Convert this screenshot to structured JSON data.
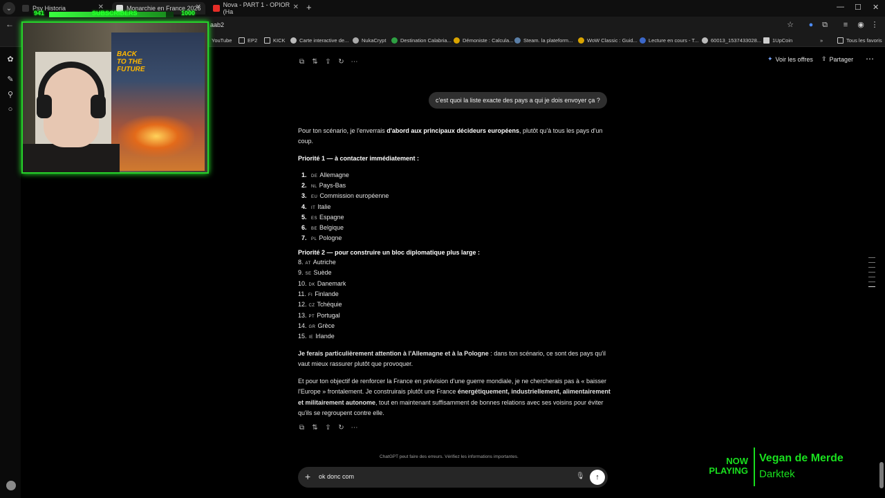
{
  "browser": {
    "tabs": [
      {
        "title": "Psy Historia"
      },
      {
        "title": "Monarchie en France 2026"
      },
      {
        "title": "Nova - PART 1 - OPIOR (Ha"
      }
    ],
    "url": "aab2",
    "bookmarks": [
      "YouTube",
      "EP2",
      "KICK",
      "Carte interactive de...",
      "NukaCrypt",
      "Destination Calabria...",
      "Démoniste : Calcula...",
      "Steam. la plateform...",
      "WoW Classic : Guid...",
      "Lecture en cours - T...",
      "60013_1537433028...",
      "1UpCoin",
      "Tous les favoris"
    ]
  },
  "header": {
    "offers_label": "Voir les offres",
    "share_label": "Partager"
  },
  "conversation": {
    "user_message": "c'est quoi la liste exacte des pays a qui je dois envoyer ça ?",
    "intro_plain_1": "Pour ton scénario, je l'enverrais ",
    "intro_bold": "d'abord aux principaux décideurs européens",
    "intro_plain_2": ", plutôt qu'à tous les pays d'un coup.",
    "priority1_heading": "Priorité 1 — à contacter immédiatement :",
    "priority1": [
      {
        "num": "1.",
        "code": "DE",
        "name": "Allemagne"
      },
      {
        "num": "2.",
        "code": "NL",
        "name": "Pays-Bas"
      },
      {
        "num": "3.",
        "code": "EU",
        "name": "Commission européenne"
      },
      {
        "num": "4.",
        "code": "IT",
        "name": "Italie"
      },
      {
        "num": "5.",
        "code": "ES",
        "name": "Espagne"
      },
      {
        "num": "6.",
        "code": "BE",
        "name": "Belgique"
      },
      {
        "num": "7.",
        "code": "PL",
        "name": "Pologne"
      }
    ],
    "priority2_heading": "Priorité 2 — pour construire un bloc diplomatique plus large :",
    "priority2": [
      {
        "num": "8.",
        "code": "AT",
        "name": "Autriche"
      },
      {
        "num": "9.",
        "code": "SE",
        "name": "Suède"
      },
      {
        "num": "10.",
        "code": "DK",
        "name": "Danemark"
      },
      {
        "num": "11.",
        "code": "FI",
        "name": "Finlande"
      },
      {
        "num": "12.",
        "code": "CZ",
        "name": "Tchéquie"
      },
      {
        "num": "13.",
        "code": "PT",
        "name": "Portugal"
      },
      {
        "num": "14.",
        "code": "GR",
        "name": "Grèce"
      },
      {
        "num": "15.",
        "code": "IE",
        "name": "Irlande"
      }
    ],
    "attention_bold": "Je ferais particulièrement attention à l'Allemagne et à la Pologne",
    "attention_plain": " : dans ton scénario, ce sont des pays qu'il vaut mieux rassurer plutôt que provoquer.",
    "final_plain_1": "Et pour ton objectif de renforcer la France en prévision d'une guerre mondiale, je ne chercherais pas à « baisser l'Europe » frontalement. Je construirais plutôt une France ",
    "final_bold": "énergétiquement, industriellement, alimentairement et militairement autonome",
    "final_plain_2": ", tout en maintenant suffisamment de bonnes relations avec ses voisins pour éviter qu'ils se regroupent contre elle."
  },
  "footer": {
    "disclaimer": "ChatGPT peut faire des erreurs. Vérifiez les informations importantes."
  },
  "composer": {
    "value": "ok donc com"
  },
  "overlay": {
    "subs_current": "941",
    "subs_label": "SUBSCRIBERS",
    "subs_goal": "1000",
    "subs_progress": 0.941,
    "poster_title": "BACK TO THE FUTURE",
    "now_playing_label": "NOW PLAYING",
    "song": "Vegan de Merde",
    "artist": "Darktek",
    "accent_color": "#19e01e"
  }
}
